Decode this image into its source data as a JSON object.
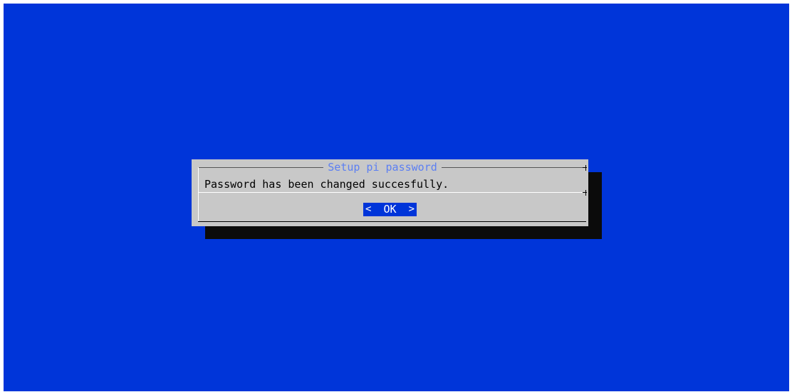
{
  "dialog": {
    "title": "Setup pi password",
    "message": "Password has been changed succesfully.",
    "ok_label": "OK",
    "left_chevron": "<",
    "right_chevron": ">"
  },
  "colors": {
    "background": "#0035d9",
    "dialog": "#c8c8c8",
    "shadow": "#0b0b0b",
    "title": "#5c7ff2",
    "button": "#0035d9"
  }
}
